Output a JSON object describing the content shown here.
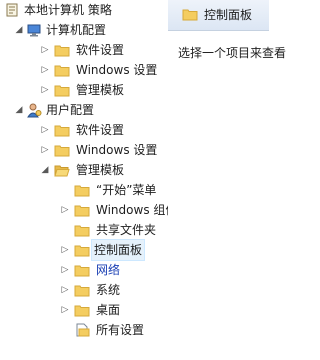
{
  "tree": {
    "root": {
      "label": "本地计算机 策略"
    },
    "computer": {
      "label": "计算机配置"
    },
    "c_software": {
      "label": "软件设置"
    },
    "c_windows": {
      "label": "Windows 设置"
    },
    "c_templates": {
      "label": "管理模板"
    },
    "user": {
      "label": "用户配置"
    },
    "u_software": {
      "label": "软件设置"
    },
    "u_windows": {
      "label": "Windows 设置"
    },
    "u_templates": {
      "label": "管理模板"
    },
    "start_menu": {
      "label": "“开始”菜单"
    },
    "windows_components": {
      "label": "Windows 组件"
    },
    "shared_folders": {
      "label": "共享文件夹"
    },
    "control_panel": {
      "label": "控制面板"
    },
    "network": {
      "label": "网络"
    },
    "system": {
      "label": "系统"
    },
    "desktop": {
      "label": "桌面"
    },
    "all_settings": {
      "label": "所有设置"
    }
  },
  "right_pane": {
    "title": "控制面板",
    "description": "选择一个项目来查看"
  },
  "colors": {
    "folder": "#f4cd60",
    "selection": "#e5f1fb",
    "link_blue": "#1a3fb4"
  }
}
